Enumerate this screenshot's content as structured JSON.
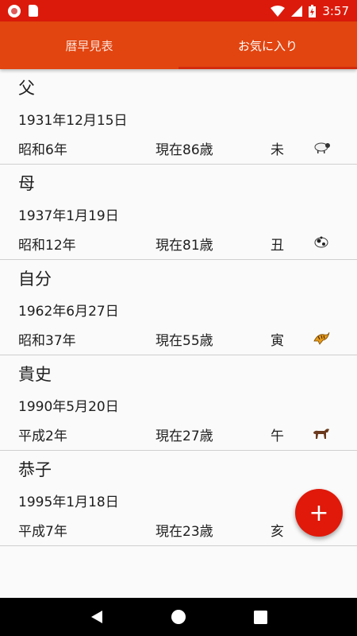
{
  "status_bar": {
    "time": "3:57"
  },
  "tabs": [
    {
      "label": "暦早見表"
    },
    {
      "label": "お気に入り"
    }
  ],
  "favorites": [
    {
      "name": "父",
      "birthdate": "1931年12月15日",
      "era_year": "昭和6年",
      "age": "現在86歳",
      "zodiac": "未",
      "animal_icon": "sheep-icon"
    },
    {
      "name": "母",
      "birthdate": "1937年1月19日",
      "era_year": "昭和12年",
      "age": "現在81歳",
      "zodiac": "丑",
      "animal_icon": "cow-icon"
    },
    {
      "name": "自分",
      "birthdate": "1962年6月27日",
      "era_year": "昭和37年",
      "age": "現在55歳",
      "zodiac": "寅",
      "animal_icon": "tiger-icon"
    },
    {
      "name": "貴史",
      "birthdate": "1990年5月20日",
      "era_year": "平成2年",
      "age": "現在27歳",
      "zodiac": "午",
      "animal_icon": "horse-icon"
    },
    {
      "name": "恭子",
      "birthdate": "1995年1月18日",
      "era_year": "平成7年",
      "age": "現在23歳",
      "zodiac": "亥",
      "animal_icon": "boar-icon"
    }
  ],
  "fab": {
    "label": "+"
  },
  "colors": {
    "status_bar": "#dc1a0b",
    "tab_bar": "#e24510",
    "fab": "#e0190a"
  }
}
